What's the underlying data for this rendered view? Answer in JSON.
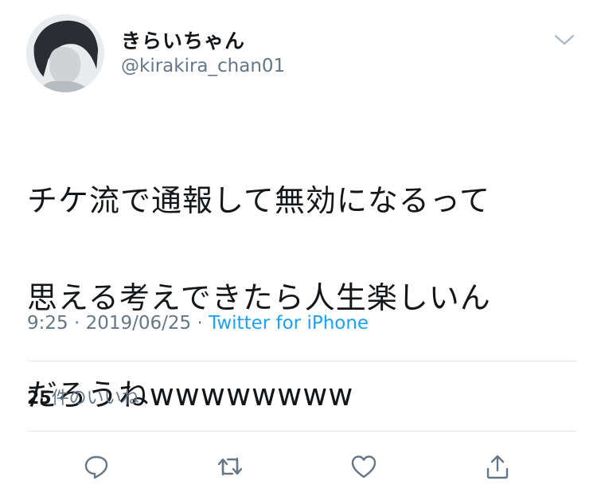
{
  "user": {
    "display_name": "きらいちゃん",
    "handle": "@kirakira_chan01"
  },
  "tweet": {
    "text_lines": [
      "チケ流で通報して無効になるって",
      "思える考えできたら人生楽しいん",
      "だろうねwwwwwwww"
    ],
    "time": "9:25",
    "separator1": " · ",
    "date": "2019/06/25",
    "separator2": " · ",
    "source": "Twitter for iPhone"
  },
  "stats": {
    "likes_count": "25",
    "likes_label": "件のいいね"
  },
  "icons": {
    "menu": "chevron-down-icon",
    "reply": "reply-icon",
    "retweet": "retweet-icon",
    "like": "heart-icon",
    "share": "share-icon"
  },
  "colors": {
    "accent": "#1da1f2",
    "secondary_text": "#657786",
    "icon": "#657786",
    "divider": "#e1e8ed"
  }
}
